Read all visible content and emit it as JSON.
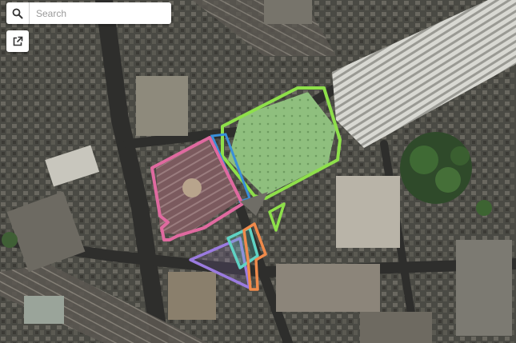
{
  "search": {
    "placeholder": "Search",
    "value": "",
    "icon": "search-icon"
  },
  "controls": {
    "open_external_icon": "open-external-icon"
  },
  "map": {
    "type": "satellite",
    "overlays": [
      {
        "name": "pink-zone",
        "color": "#e06aa0"
      },
      {
        "name": "green-zone",
        "color": "#8ee04a"
      },
      {
        "name": "green-triangle",
        "color": "#8ee04a"
      },
      {
        "name": "blue-strip",
        "color": "#3a8fd8"
      },
      {
        "name": "teal-zone",
        "color": "#5fd3c4"
      },
      {
        "name": "orange-zone",
        "color": "#f08a4b"
      },
      {
        "name": "purple-zone",
        "color": "#9b7be0"
      }
    ]
  }
}
